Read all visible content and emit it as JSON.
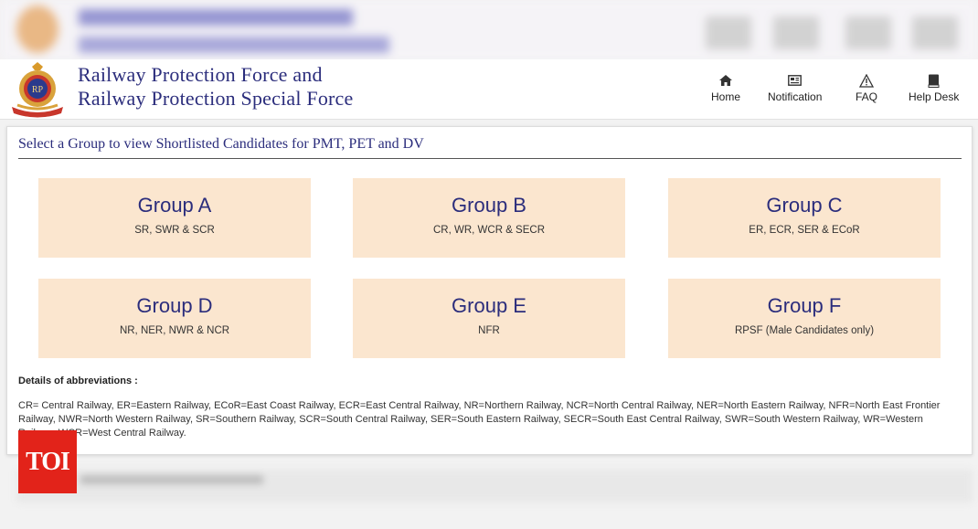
{
  "header": {
    "title_line1": "Railway Protection Force and",
    "title_line2": "Railway Protection Special Force",
    "nav": [
      {
        "label": "Home",
        "icon": "home-icon"
      },
      {
        "label": "Notification",
        "icon": "notification-icon"
      },
      {
        "label": "FAQ",
        "icon": "warning-icon"
      },
      {
        "label": "Help Desk",
        "icon": "book-icon"
      }
    ]
  },
  "main": {
    "heading": "Select a Group to view Shortlisted Candidates for PMT, PET and DV",
    "groups": [
      {
        "name": "Group A",
        "zones": "SR, SWR & SCR"
      },
      {
        "name": "Group B",
        "zones": "CR, WR, WCR & SECR"
      },
      {
        "name": "Group C",
        "zones": "ER, ECR, SER & ECoR"
      },
      {
        "name": "Group D",
        "zones": "NR, NER, NWR & NCR"
      },
      {
        "name": "Group E",
        "zones": "NFR"
      },
      {
        "name": "Group F",
        "zones": "RPSF (Male Candidates only)"
      }
    ],
    "abbr_title": "Details of abbreviations :",
    "abbr_text": "CR= Central Railway, ER=Eastern Railway, ECoR=East Coast Railway, ECR=East Central Railway, NR=Northern Railway, NCR=North Central Railway, NER=North Eastern Railway, NFR=North East Frontier Railway, NWR=North Western Railway, SR=Southern Railway, SCR=South Central Railway, SER=South Eastern Railway, SECR=South East Central Railway, SWR=South Western Railway, WR=Western Railway, WCR=West Central Railway."
  },
  "badge": {
    "label": "TOI"
  },
  "colors": {
    "accent": "#2b2d7c",
    "tile_bg": "#fbe6cf",
    "badge": "#e2231a"
  }
}
